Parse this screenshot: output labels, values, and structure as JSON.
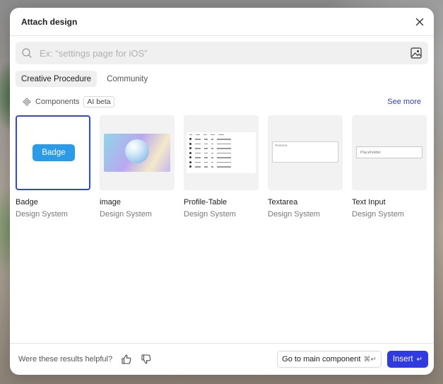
{
  "dialog": {
    "title": "Attach design",
    "close_icon": "close-icon"
  },
  "search": {
    "placeholder": "Ex: “settings page for iOS”",
    "value": "",
    "icon": "search-icon",
    "image_button_icon": "image-icon"
  },
  "tabs": [
    {
      "label": "Creative Procedure",
      "active": true
    },
    {
      "label": "Community",
      "active": false
    }
  ],
  "section": {
    "icon": "components-icon",
    "label": "Components",
    "badge": "AI beta",
    "see_more": "See more"
  },
  "cards": [
    {
      "name": "Badge",
      "source": "Design System",
      "selected": true,
      "preview_text": "Badge"
    },
    {
      "name": "image",
      "source": "Design System",
      "selected": false
    },
    {
      "name": "Profile-Table",
      "source": "Design System",
      "selected": false
    },
    {
      "name": "Textarea",
      "source": "Design System",
      "selected": false,
      "preview_text": "Textarea"
    },
    {
      "name": "Text Input",
      "source": "Design System",
      "selected": false,
      "preview_text": "Placeholder"
    }
  ],
  "footer": {
    "helpful_text": "Were these results helpful?",
    "thumbs_up_icon": "thumbs-up-icon",
    "thumbs_down_icon": "thumbs-down-icon",
    "goto_label": "Go to main component",
    "goto_shortcut": "⌘↵",
    "insert_label": "Insert",
    "insert_shortcut": "↵"
  },
  "colors": {
    "accent": "#2f3be0",
    "link": "#2d3fd4",
    "badge_blue": "#2b9be8"
  }
}
